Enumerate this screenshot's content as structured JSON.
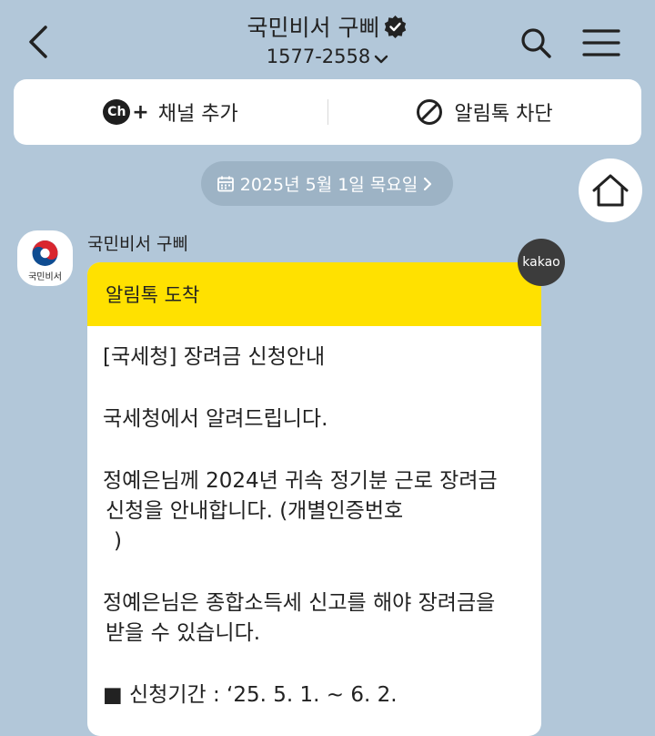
{
  "header": {
    "title": "국민비서 구삐",
    "phone": "1577-2558",
    "icons": [
      "back-arrow-icon",
      "verified-badge-icon",
      "chevron-down-icon",
      "search-icon",
      "hamburger-menu-icon"
    ]
  },
  "actions": {
    "add_channel": "채널 추가",
    "block_alimtalk": "알림톡 차단",
    "ch_icon_text": "Ch"
  },
  "date_pill": {
    "label": "2025년 5월 1일 목요일"
  },
  "message": {
    "sender": "국민비서 구삐",
    "avatar_label": "국민비서",
    "badge": "kakao",
    "header": "알림톡 도착",
    "lines": {
      "l1": "[국세청] 장려금 신청안내",
      "l2": "국세청에서 알려드립니다.",
      "l3a": "정예은님께 2024년 귀속 정기분 근로 장려금",
      "l3b": "신청을 안내합니다. (개별인증번호",
      "l3c": ")",
      "l4a": "정예은님은 종합소득세 신고를 해야 장려금을",
      "l4b": "받을 수 있습니다.",
      "l5": "■ 신청기간 : ‘25. 5. 1. ~ 6. 2."
    }
  },
  "colors": {
    "background": "#b2c7d9",
    "bubble_header": "#ffe100",
    "date_pill": "#9db3c5",
    "kakao_badge": "#3c3c3c"
  }
}
